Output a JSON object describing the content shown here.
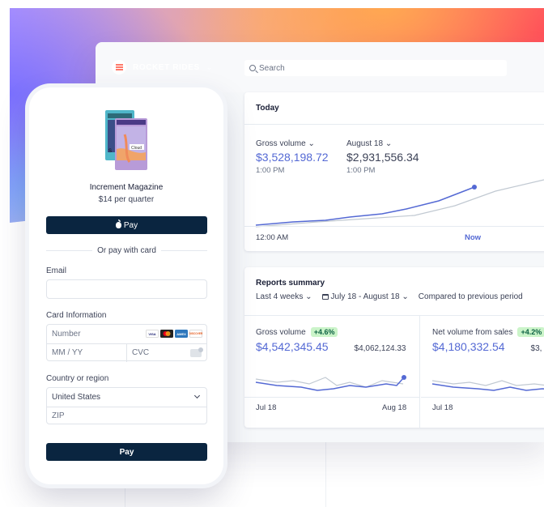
{
  "dashboard": {
    "brand": {
      "name": "ROCKET RIDES",
      "icon": "rocket-rides-logo"
    },
    "search": {
      "placeholder": "Search"
    },
    "today": {
      "title": "Today",
      "gross": {
        "label": "Gross volume",
        "value": "$3,528,198.72",
        "time": "1:00 PM"
      },
      "compare": {
        "label": "August 18",
        "value": "$2,931,556.34",
        "time": "1:00 PM"
      },
      "axis_start": "12:00 AM",
      "axis_now": "Now"
    },
    "reports": {
      "title": "Reports summary",
      "period": "Last 4 weeks",
      "date_range": "July 18 - August 18",
      "compare": "Compared to previous period",
      "gross": {
        "label": "Gross volume",
        "badge": "+4.6%",
        "value": "$4,542,345.45",
        "previous": "$4,062,124.33",
        "axis_start": "Jul 18",
        "axis_end": "Aug 18"
      },
      "net": {
        "label": "Net volume from sales",
        "badge": "+4.2%",
        "value": "$4,180,332.54",
        "previous": "$3,",
        "axis_start": "Jul 18"
      }
    },
    "colors": {
      "accent": "#5469d4",
      "navy": "#0a2540",
      "badge_bg": "#cbf4c9",
      "badge_fg": "#0e6245"
    }
  },
  "checkout": {
    "product_name": "Increment Magazine",
    "price": "$14 per quarter",
    "cover_text": {
      "back": "S",
      "front": "Cloud"
    },
    "apple_pay_label": "Pay",
    "or_pay": "Or pay with card",
    "email_label": "Email",
    "email_value": "",
    "card_label": "Card Information",
    "card_number_placeholder": "Number",
    "card_expiry_placeholder": "MM / YY",
    "card_cvc_placeholder": "CVC",
    "card_brands": [
      "VISA",
      "mastercard",
      "AMEX",
      "DISCOVER"
    ],
    "country_label": "Country or region",
    "country_value": "United States",
    "zip_placeholder": "ZIP",
    "pay_label": "Pay"
  }
}
